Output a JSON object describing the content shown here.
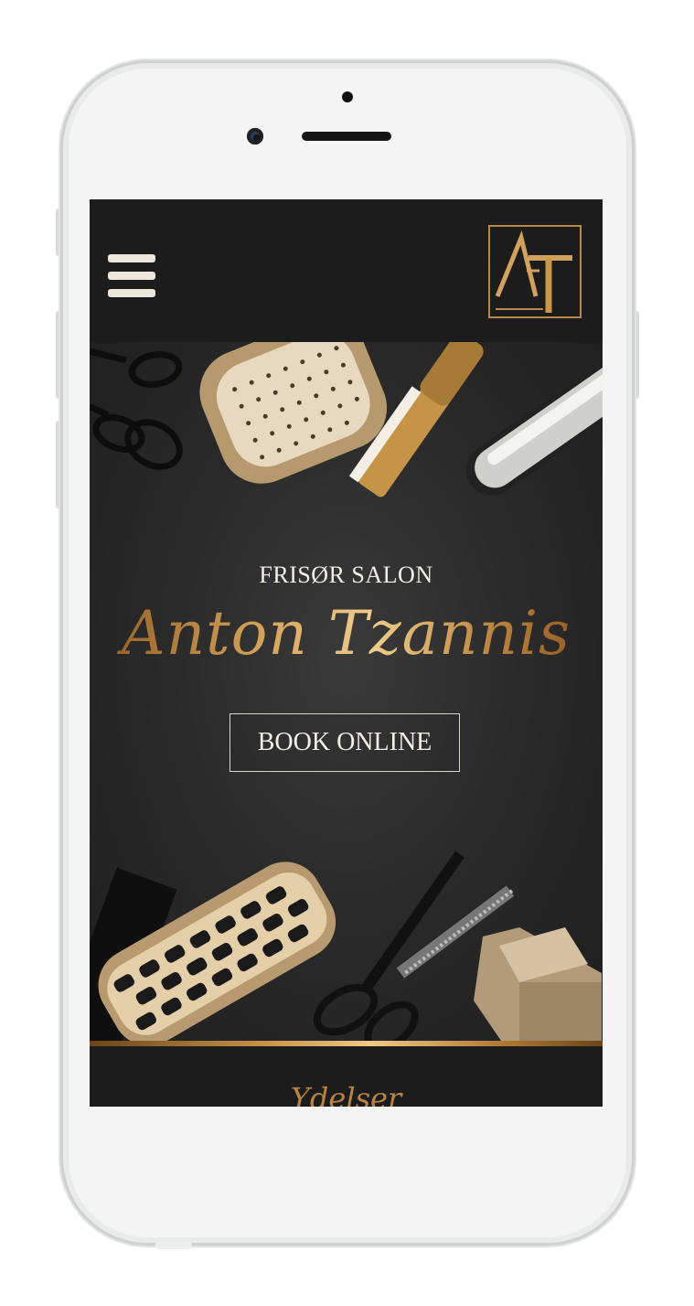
{
  "header": {
    "menu_icon": "hamburger-menu-icon",
    "logo_text": "AT"
  },
  "hero": {
    "subtitle": "FRISØR SALON",
    "name": "Anton Tzannis",
    "book_button": "BOOK ONLINE"
  },
  "section": {
    "title": "Ydelser"
  },
  "colors": {
    "header_bg": "#1c1c1c",
    "gold": "#c18a3e",
    "text_light": "#f2efe8"
  }
}
